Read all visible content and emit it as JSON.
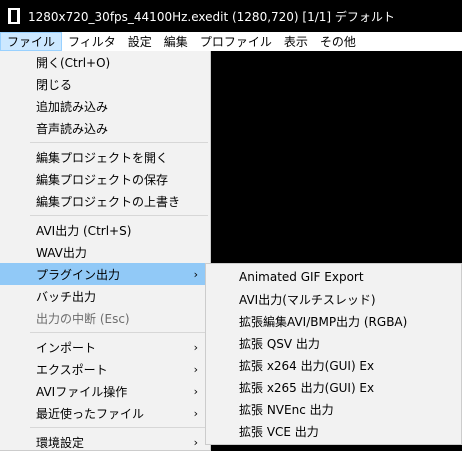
{
  "window": {
    "title": "1280x720_30fps_44100Hz.exedit (1280,720)  [1/1]  デフォルト"
  },
  "menubar": {
    "items": [
      "ファイル",
      "フィルタ",
      "設定",
      "編集",
      "プロファイル",
      "表示",
      "その他"
    ]
  },
  "file_menu": {
    "open": "開く(Ctrl+O)",
    "close": "閉じる",
    "add_load": "追加読み込み",
    "audio_load": "音声読み込み",
    "open_project": "編集プロジェクトを開く",
    "save_project": "編集プロジェクトの保存",
    "overwrite_project": "編集プロジェクトの上書き",
    "avi_output": "AVI出力 (Ctrl+S)",
    "wav_output": "WAV出力",
    "plugin_output": "プラグイン出力",
    "batch_output": "バッチ出力",
    "stop_output": "出力の中断 (Esc)",
    "import": "インポート",
    "export": "エクスポート",
    "avi_file_ops": "AVIファイル操作",
    "recent_files": "最近使ったファイル",
    "env_settings": "環境設定",
    "arrow": "›"
  },
  "plugin_submenu": {
    "items": [
      "Animated GIF Export",
      "AVI出力(マルチスレッド)",
      "拡張編集AVI/BMP出力 (RGBA)",
      "拡張 QSV 出力",
      "拡張 x264 出力(GUI) Ex",
      "拡張 x265 出力(GUI) Ex",
      "拡張 NVEnc 出力",
      "拡張 VCE 出力"
    ]
  }
}
